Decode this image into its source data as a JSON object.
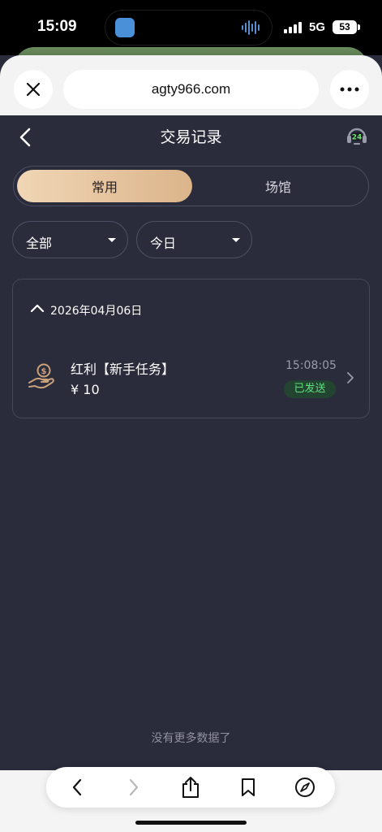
{
  "status_bar": {
    "time": "15:09",
    "network": "5G",
    "battery": "53"
  },
  "browser": {
    "url": "agty966.com"
  },
  "header": {
    "title": "交易记录"
  },
  "tabs": [
    {
      "label": "常用",
      "active": true
    },
    {
      "label": "场馆",
      "active": false
    }
  ],
  "filters": {
    "category": "全部",
    "period": "今日"
  },
  "records": {
    "date": "2026年04月06日",
    "items": [
      {
        "name": "红利【新手任务】",
        "amount": "¥ 10",
        "time": "15:08:05",
        "status": "已发送"
      }
    ]
  },
  "footer_note": "没有更多数据了",
  "colors": {
    "page_bg": "#2a2b3b",
    "tab_active_gradient_start": "#f0d6b5",
    "tab_active_gradient_end": "#dbb48a",
    "status_sent_text": "#5ee07e",
    "status_sent_bg": "#234430"
  },
  "icons": {
    "browser_close": "close-icon",
    "browser_more": "more-icon",
    "header_back": "back-icon",
    "header_support": "support-24h-icon",
    "record_icon": "hand-coin-icon",
    "toolbar": [
      "back-icon",
      "forward-icon",
      "share-icon",
      "bookmarks-icon",
      "compass-icon"
    ]
  }
}
